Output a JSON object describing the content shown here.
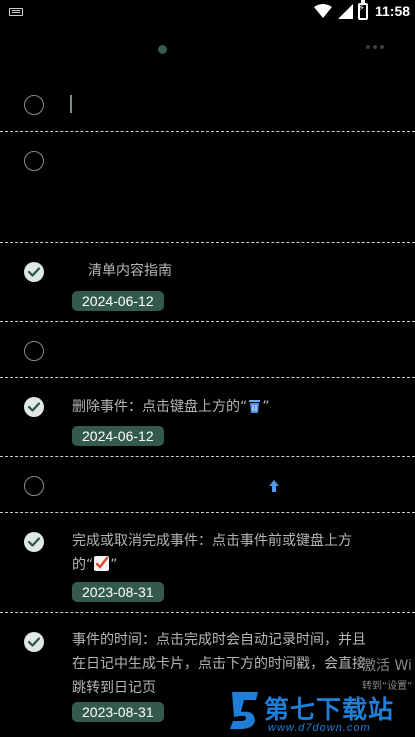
{
  "status_bar": {
    "time": "11:58"
  },
  "items": [
    {
      "id": "r0",
      "checked": false,
      "text": ""
    },
    {
      "id": "r1",
      "checked": false,
      "text": ""
    },
    {
      "id": "r2",
      "checked": true,
      "text": "清单内容指南",
      "date": "2024-06-12"
    },
    {
      "id": "r3",
      "checked": false,
      "text": ""
    },
    {
      "id": "r4",
      "checked": true,
      "text_before": "删除事件：点击键盘上方的“",
      "emoji": "trash-icon",
      "text_after": "”",
      "date": "2024-06-12"
    },
    {
      "id": "r5",
      "checked": false,
      "text": ""
    },
    {
      "id": "r6",
      "checked": true,
      "line1": "完成或取消完成事件：点击事件前或键盘上方",
      "line2_before": "的“",
      "emoji": "check-mark-icon",
      "line2_after": "”",
      "date": "2023-08-31"
    },
    {
      "id": "r7",
      "checked": true,
      "line1": "事件的时间：点击完成时会自动记录时间，并且",
      "line2": "在日记中生成卡片，点击下方的时间戳，会直接",
      "line3": "跳转到日记页",
      "date": "2023-08-31"
    }
  ],
  "watermark": {
    "activate": "激活 Wi",
    "sub": "转到“设置”",
    "brand": "第七下载站",
    "url": "www.d7down.com"
  },
  "colors": {
    "accent": "#345a4c",
    "checkbox_done": "#e0e8e4",
    "background": "#000000"
  }
}
